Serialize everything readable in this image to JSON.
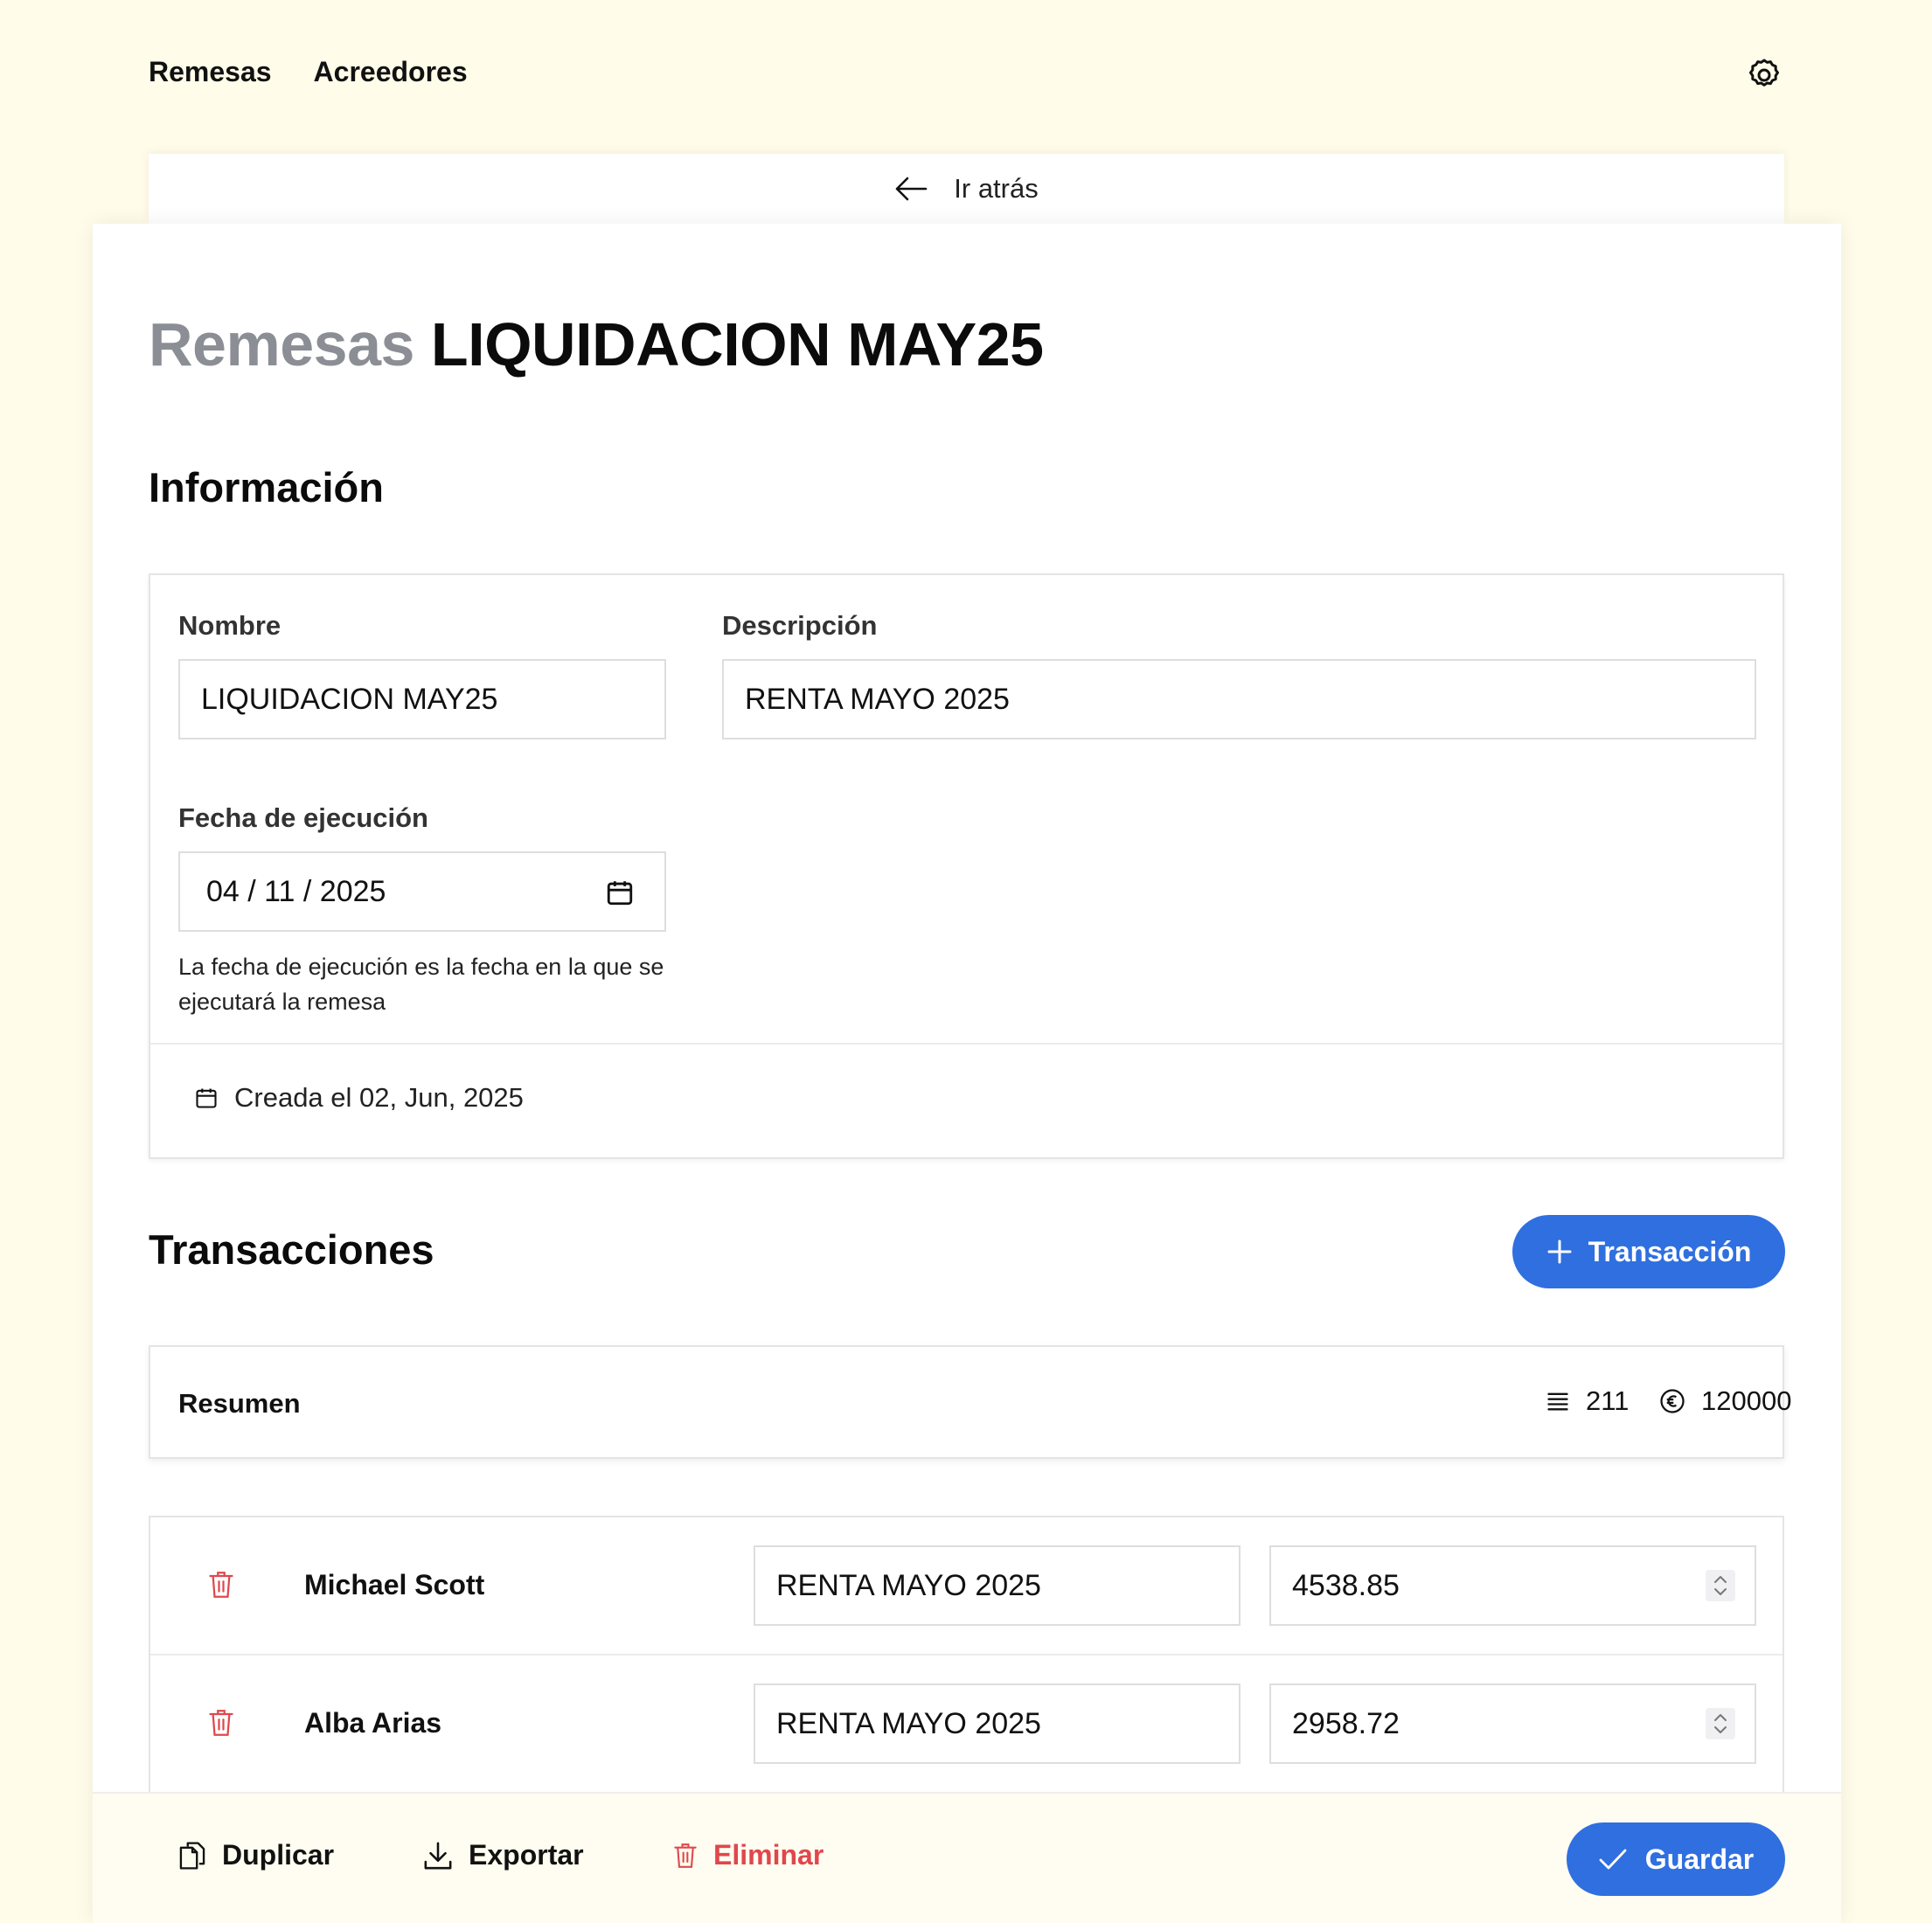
{
  "nav": {
    "items": [
      "Remesas",
      "Acreedores"
    ]
  },
  "back": {
    "label": "Ir atrás"
  },
  "page": {
    "title_prefix": "Remesas",
    "title_name": "LIQUIDACION MAY25"
  },
  "info": {
    "heading": "Información",
    "nombre_label": "Nombre",
    "nombre_value": "LIQUIDACION MAY25",
    "descripcion_label": "Descripción",
    "descripcion_value": "RENTA MAYO 2025",
    "fecha_label": "Fecha de ejecución",
    "fecha_value": "04 / 11 / 2025",
    "fecha_hint": "La fecha de ejecución es la fecha en la que se ejecutará la remesa",
    "created": "Creada el 02, Jun, 2025"
  },
  "transactions": {
    "heading": "Transacciones",
    "add_label": "Transacción",
    "summary_label": "Resumen",
    "count": "211",
    "total": "120000",
    "rows": [
      {
        "name": "Michael Scott",
        "description": "RENTA MAYO 2025",
        "amount": "4538.85"
      },
      {
        "name": "Alba Arias",
        "description": "RENTA MAYO 2025",
        "amount": "2958.72"
      }
    ]
  },
  "footer": {
    "duplicate": "Duplicar",
    "export": "Exportar",
    "delete": "Eliminar",
    "save": "Guardar"
  },
  "colors": {
    "background": "#fffce9",
    "accent": "#2f6fe0",
    "danger": "#e0474c",
    "muted": "#8b8e94"
  }
}
